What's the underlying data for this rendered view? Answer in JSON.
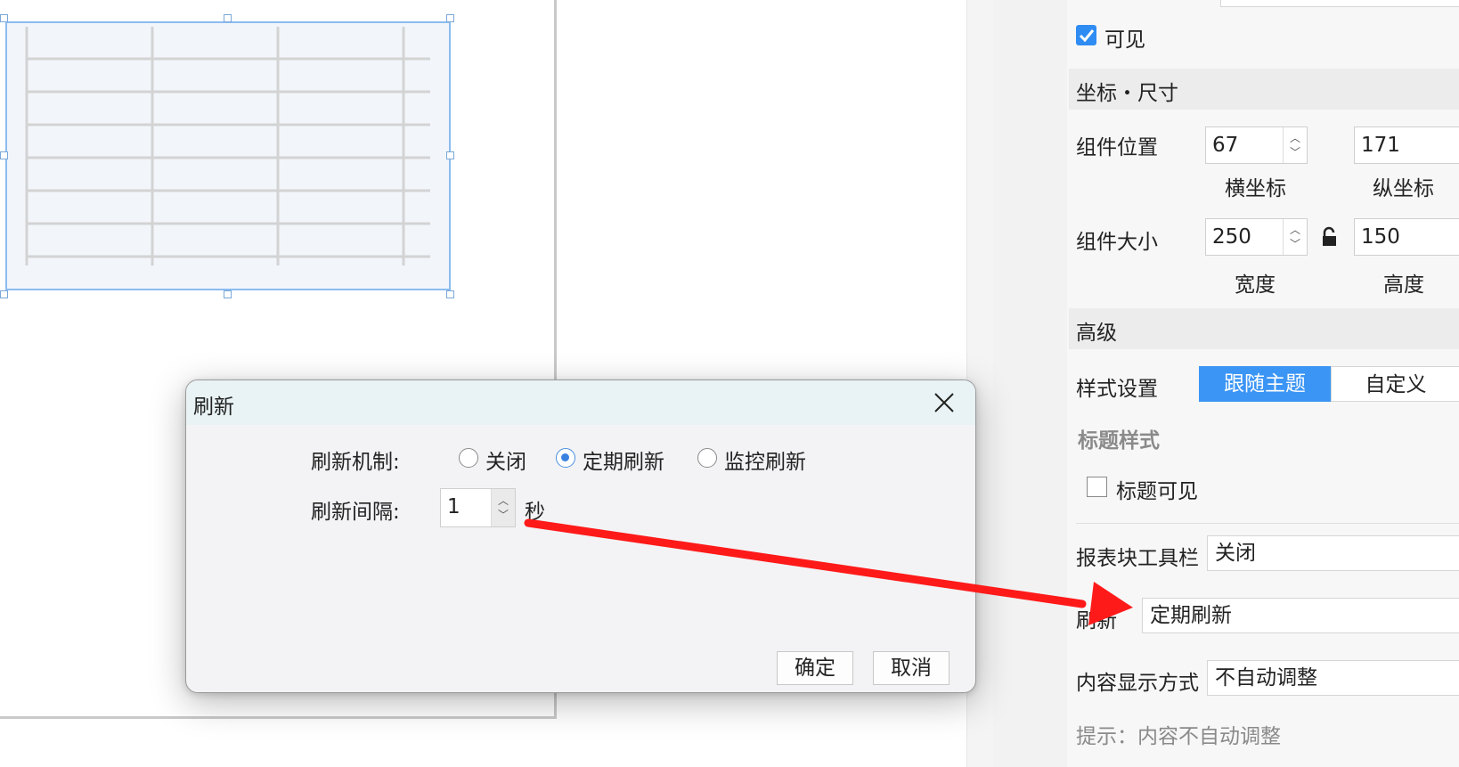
{
  "panel": {
    "visible_label": "可见",
    "visible_checked": true,
    "section_geometry": "坐标・尺寸",
    "position_label": "组件位置",
    "x_value": "67",
    "x_caption": "横坐标",
    "y_value": "171",
    "y_caption": "纵坐标",
    "size_label": "组件大小",
    "width_value": "250",
    "width_caption": "宽度",
    "height_value": "150",
    "height_caption": "高度",
    "section_advanced": "高级",
    "style_label": "样式设置",
    "style_follow_theme": "跟随主题",
    "style_custom": "自定义",
    "title_style_heading": "标题样式",
    "title_visible_label": "标题可见",
    "title_visible_checked": false,
    "toolbar_label": "报表块工具栏",
    "toolbar_value": "关闭",
    "refresh_label": "刷新",
    "refresh_value": "定期刷新",
    "content_display_label": "内容显示方式",
    "content_display_value": "不自动调整",
    "hint_text": "提示：内容不自动调整"
  },
  "dialog": {
    "title": "刷新",
    "mechanism_label": "刷新机制:",
    "options": [
      "关闭",
      "定期刷新",
      "监控刷新"
    ],
    "selected_index": 1,
    "interval_label": "刷新间隔:",
    "interval_value": "1",
    "interval_unit": "秒",
    "ok_label": "确定",
    "cancel_label": "取消"
  },
  "colors": {
    "accent": "#3b95f5",
    "annotation_arrow": "#ff1a1a",
    "selection_border": "#8cbcf0"
  }
}
